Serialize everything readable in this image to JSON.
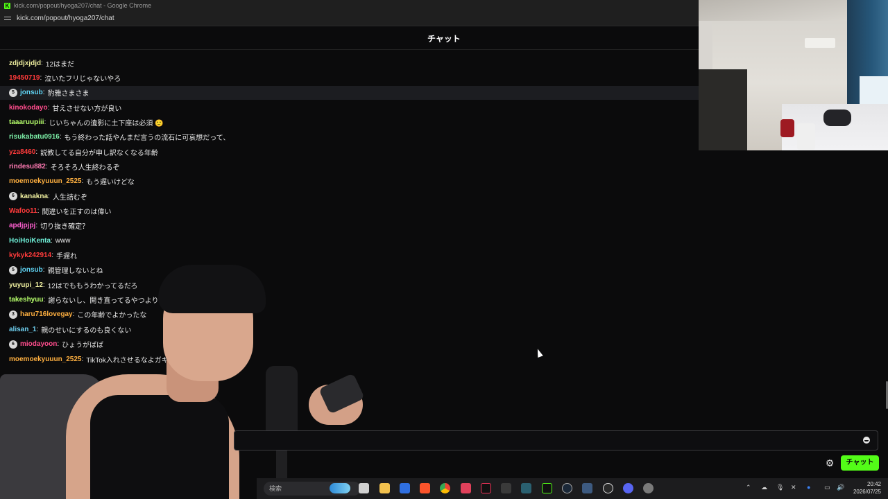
{
  "window": {
    "title": "kick.com/popout/hyoga207/chat - Google Chrome",
    "url": "kick.com/popout/hyoga207/chat"
  },
  "chat": {
    "title": "チャット",
    "send_label": "チャット",
    "messages": [
      {
        "badge": "",
        "user": "zdjdjxjdjd",
        "color": "#f0f0a0",
        "text": "12はまだ"
      },
      {
        "badge": "",
        "user": "19450719",
        "color": "#ff3b3b",
        "text": "泣いたフリじゃないやろ"
      },
      {
        "badge": "5",
        "user": "jonsub",
        "color": "#5fd3f3",
        "text": "豹雅さまさま"
      },
      {
        "badge": "",
        "user": "kinokodayo",
        "color": "#ff4d8d",
        "text": "甘えさせない方が良い"
      },
      {
        "badge": "",
        "user": "taaaruupiii",
        "color": "#b6ff6b",
        "text": "じいちゃんの遺影に土下座は必須 🙂"
      },
      {
        "badge": "",
        "user": "risukabatu0916",
        "color": "#7df0a8",
        "text": "もう終わった話やんまだ言うの流石に可哀想だって、"
      },
      {
        "badge": "",
        "user": "yza8460",
        "color": "#ff3b3b",
        "text": "説教してる自分が申し訳なくなる年齢"
      },
      {
        "badge": "",
        "user": "rindesu882",
        "color": "#ff7ab3",
        "text": "そろそろ人生終わるぞ"
      },
      {
        "badge": "",
        "user": "moemoekyuuun_2525",
        "color": "#ffb040",
        "text": "もう遅いけどな"
      },
      {
        "badge": "6",
        "user": "kanakna",
        "color": "#f0f0a0",
        "text": "人生詰むぞ"
      },
      {
        "badge": "",
        "user": "Wafoo11",
        "color": "#ff3b3b",
        "text": "間違いを正すのは偉い"
      },
      {
        "badge": "",
        "user": "apdjpjpj",
        "color": "#ff5fd0",
        "text": "切り抜き確定？"
      },
      {
        "badge": "",
        "user": "HoiHoiKenta",
        "color": "#6ff0d8",
        "text": "www"
      },
      {
        "badge": "",
        "user": "kykyk242914",
        "color": "#ff3b3b",
        "text": "手遅れ"
      },
      {
        "badge": "5",
        "user": "jonsub",
        "color": "#5fd3f3",
        "text": "親管理しないとね"
      },
      {
        "badge": "",
        "user": "yuyupi_12",
        "color": "#f0f0a0",
        "text": "12はでももうわかってるだろ"
      },
      {
        "badge": "",
        "user": "takeshyuu",
        "color": "#b6ff6b",
        "text": "謝らないし、開き直ってるやつよりは全然"
      },
      {
        "badge": "3",
        "user": "haru716lovegay",
        "color": "#ffb040",
        "text": "この年齢でよかったな"
      },
      {
        "badge": "",
        "user": "alisan_1",
        "color": "#6fd0f0",
        "text": "親のせいにするのも良くない"
      },
      {
        "badge": "6",
        "user": "miodayoon",
        "color": "#ff4d8d",
        "text": "ひょうがばば"
      },
      {
        "badge": "",
        "user": "moemoekyuuun_2525",
        "color": "#ffb040",
        "text": "TikTok入れさせるなよガキに"
      }
    ]
  },
  "taskbar": {
    "search_placeholder": "検索",
    "time": "20:42",
    "date": "2026/07/25"
  }
}
